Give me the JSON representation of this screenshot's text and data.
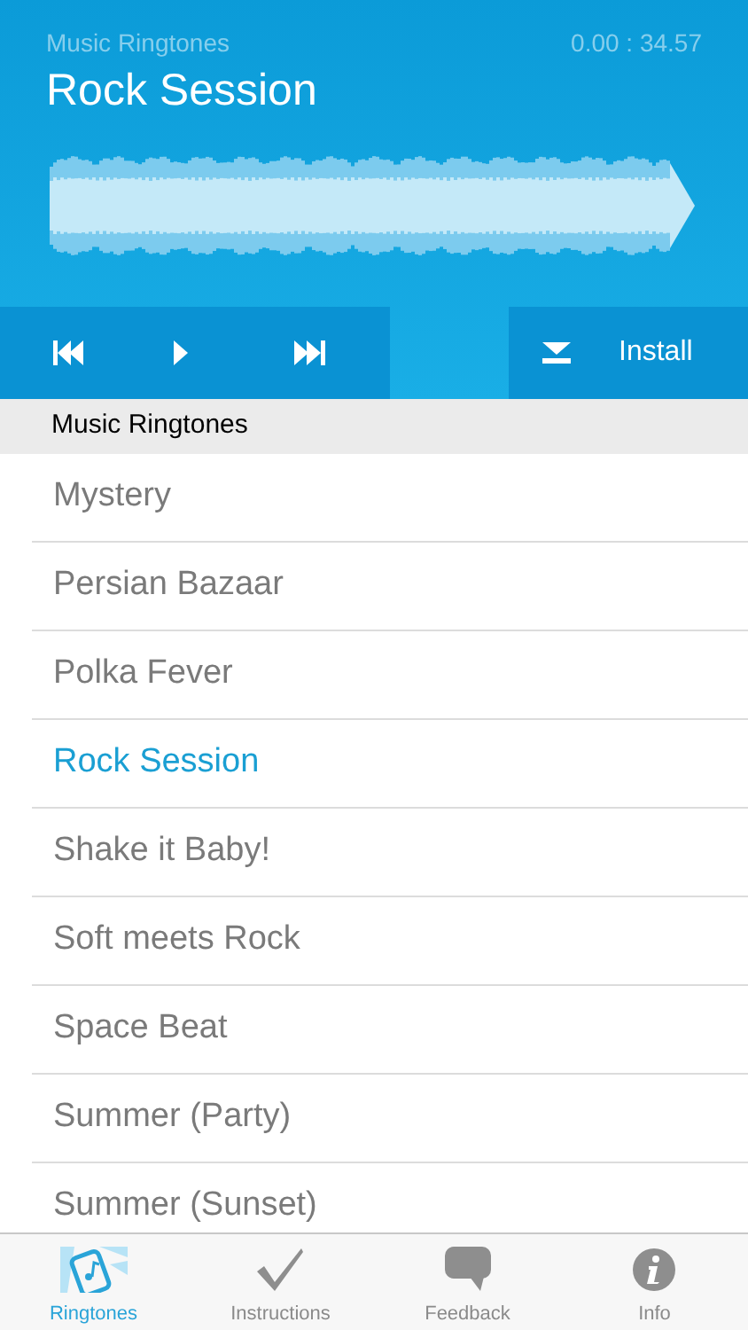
{
  "player": {
    "category": "Music Ringtones",
    "time": "0.00 : 34.57",
    "title": "Rock Session",
    "install_label": "Install"
  },
  "section_header": "Music Ringtones",
  "ringtones": [
    {
      "name": "Mystery",
      "selected": false
    },
    {
      "name": "Persian Bazaar",
      "selected": false
    },
    {
      "name": "Polka Fever",
      "selected": false
    },
    {
      "name": "Rock Session",
      "selected": true
    },
    {
      "name": "Shake it Baby!",
      "selected": false
    },
    {
      "name": "Soft meets Rock",
      "selected": false
    },
    {
      "name": "Space Beat",
      "selected": false
    },
    {
      "name": "Summer (Party)",
      "selected": false
    },
    {
      "name": "Summer (Sunset)",
      "selected": false
    }
  ],
  "tab_bar": [
    {
      "label": "Ringtones",
      "kind": "ringtones",
      "selected": true
    },
    {
      "label": "Instructions",
      "kind": "check",
      "selected": false
    },
    {
      "label": "Feedback",
      "kind": "chat",
      "selected": false
    },
    {
      "label": "Info",
      "kind": "info",
      "selected": false
    }
  ]
}
